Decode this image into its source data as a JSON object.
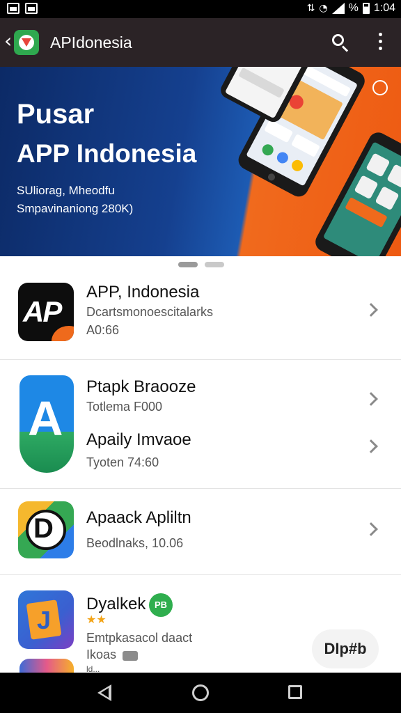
{
  "status_bar": {
    "percent": "%",
    "time": "1:04"
  },
  "app_bar": {
    "title": "APIdonesia",
    "back_glyph": "‹"
  },
  "banner": {
    "title_line1": "Pusar",
    "title_line2": "APP Indonesia",
    "subtitle_line1": "SUliorag, Mheodfu",
    "subtitle_line2": "Smpavinaniong 280K)"
  },
  "list": {
    "item1": {
      "title": "APP, Indonesia",
      "subtitle": "Dcartsmonoescitalarks",
      "meta": "A0:66"
    },
    "item2": {
      "title": "Ptapk Braooze",
      "subtitle": "Totlema F000",
      "title2": "Apaily Imvaoe",
      "meta2": "Tyoten 74:60"
    },
    "item3": {
      "title": "Apaack Apliltn",
      "subtitle": "Beodlnaks, 10.06"
    },
    "item4": {
      "title": "Dyalkek",
      "badge": "PB",
      "stars": "★★",
      "subtitle": "Emtpkasacol daact",
      "meta": "Ikoas"
    },
    "item5": {
      "title": "ld..."
    }
  },
  "floating_button": {
    "label": "DIp#b"
  },
  "icons": {
    "status_left": [
      "notification-icon",
      "gallery-icon"
    ],
    "status_right": [
      "vibrate-icon",
      "wifi-icon",
      "signal-icon",
      "battery-icon"
    ],
    "app_bar": [
      "back-icon",
      "app-logo-icon",
      "search-icon",
      "more-vert-icon"
    ],
    "nav_bar": [
      "nav-back-icon",
      "nav-home-icon",
      "nav-recents-icon"
    ]
  }
}
